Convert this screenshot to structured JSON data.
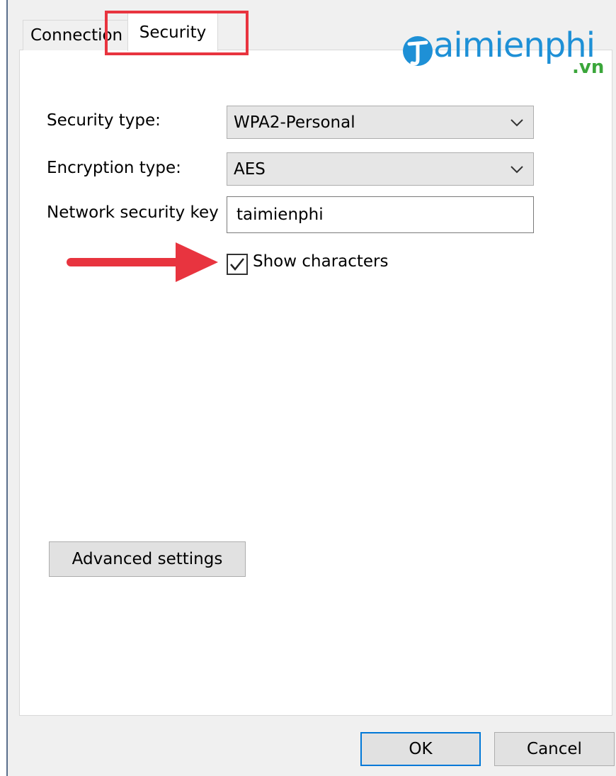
{
  "tabs": [
    {
      "label": "Connection",
      "active": false
    },
    {
      "label": "Security",
      "active": true
    }
  ],
  "logo": {
    "initial": "T",
    "text": "aimienphi",
    "suffix": ".vn",
    "colors": {
      "primary": "#1e90d6",
      "suffix": "#3aa63a"
    }
  },
  "form": {
    "security_type": {
      "label": "Security type:",
      "value": "WPA2-Personal"
    },
    "encryption_type": {
      "label": "Encryption type:",
      "value": "AES"
    },
    "network_key": {
      "label": "Network security key",
      "value": "taimienphi"
    },
    "show_characters": {
      "label": "Show characters",
      "checked": true
    }
  },
  "buttons": {
    "advanced": "Advanced settings",
    "ok": "OK",
    "cancel": "Cancel"
  },
  "annotations": {
    "highlight_color": "#e8343f",
    "arrow_color": "#e8343f"
  },
  "icons": {
    "dropdown": "chevron-down-icon",
    "check": "checkmark-icon",
    "arrow": "arrow-right-icon"
  }
}
